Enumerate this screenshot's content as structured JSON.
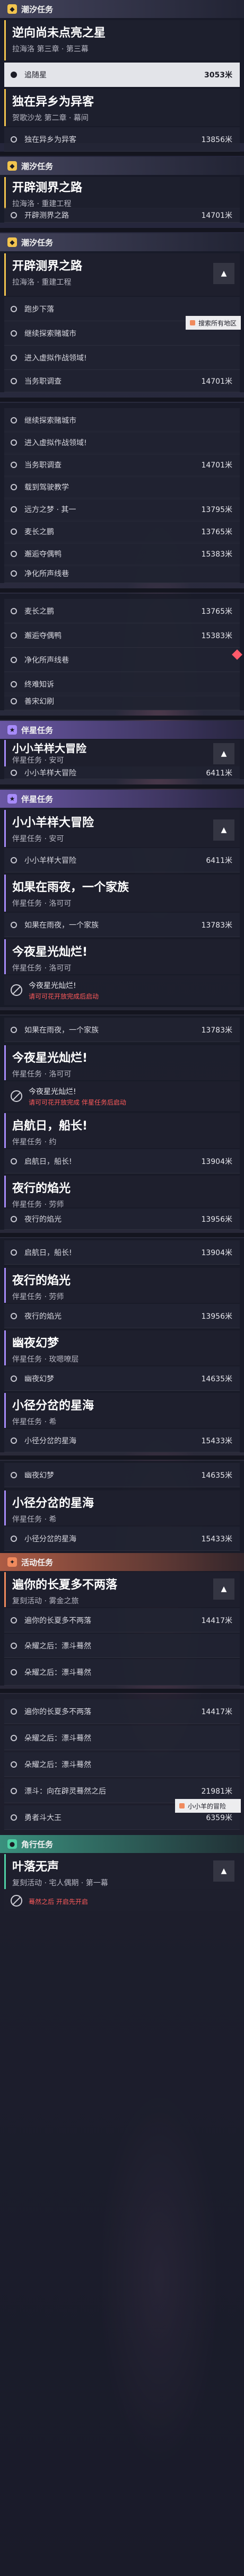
{
  "sections": {
    "main_label": "潮汐任务",
    "side_label": "伴星任务",
    "event_label": "活动任务",
    "daily_label": "角行任务"
  },
  "s1": {
    "title": "逆向尚未点亮之星",
    "sub": "拉海洛 第三章 · 第三幕",
    "active_row": {
      "label": "追随星",
      "dist": "3053米"
    },
    "card2_title": "独在异乡为异客",
    "card2_sub": "贺歌沙龙 第二章 · 幕间",
    "row2": {
      "label": "独在异乡为异客",
      "dist": "13856米"
    }
  },
  "s2": {
    "title": "开辟测界之路",
    "sub": "拉海洛 · 重建工程",
    "row": {
      "label": "开辟测界之路",
      "dist": "14701米"
    }
  },
  "s3": {
    "title": "开辟测界之路",
    "sub": "拉海洛 · 重建工程",
    "rows": [
      {
        "label": "跑步下落",
        "dist": ""
      },
      {
        "label": "继续探索赌城市",
        "dist": ""
      },
      {
        "label": "进入虚拟作战领域!",
        "dist": ""
      },
      {
        "label": "当务职调查",
        "dist": "14701米"
      }
    ],
    "tag": "搜索所有地区"
  },
  "s4": {
    "rows": [
      {
        "label": "继续探索赌城市",
        "dist": ""
      },
      {
        "label": "进入虚拟作战领域!",
        "dist": ""
      },
      {
        "label": "当务职调查",
        "dist": "14701米"
      },
      {
        "label": "载到驾驶教学",
        "dist": ""
      },
      {
        "label": "远方之梦 · 其一",
        "dist": "13795米"
      },
      {
        "label": "麦长之鹏",
        "dist": "13765米"
      },
      {
        "label": "邂逅夺偶鸭",
        "dist": "15383米"
      },
      {
        "label": "净化所声线巷",
        "dist": ""
      }
    ]
  },
  "s5": {
    "rows": [
      {
        "label": "麦长之鹏",
        "dist": "13765米"
      },
      {
        "label": "邂逅夺偶鸭",
        "dist": "15383米"
      },
      {
        "label": "净化所声线巷",
        "dist": ""
      },
      {
        "label": "终难知诉",
        "dist": ""
      },
      {
        "label": "善宋幻刷",
        "dist": ""
      }
    ]
  },
  "s6": {
    "title": "小小羊样大冒险",
    "sub": "伴星任务 · 安可",
    "row": {
      "label": "小小羊样大冒险",
      "dist": "6411米"
    }
  },
  "s7": {
    "card1_title": "小小羊样大冒险",
    "card1_sub": "伴星任务 · 安可",
    "row1": {
      "label": "小小羊样大冒险",
      "dist": "6411米"
    },
    "card2_title": "如果在雨夜，一个家族",
    "card2_sub": "伴星任务 · 洛可可",
    "row2": {
      "label": "如果在雨夜，一个家族",
      "dist": "13783米"
    },
    "card3_title": "今夜星光灿烂!",
    "card3_sub": "伴星任务 · 洛可可",
    "warn1_main": "今夜星光灿烂!",
    "warn1_red": "请可可花开放完成后启动"
  },
  "s8": {
    "row1": {
      "label": "如果在雨夜，一个家族",
      "dist": "13783米"
    },
    "card1_title": "今夜星光灿烂!",
    "card1_sub": "伴星任务 · 洛可可",
    "warn_main": "今夜星光灿烂!",
    "warn_red": "请可可花开放完成 伴星任务后启动",
    "card2_title": "启航日，船长!",
    "card2_sub": "伴星任务 · 约",
    "row2": {
      "label": "启航日，船长!",
      "dist": "13904米"
    },
    "card3_title": "夜行的焰光",
    "card3_sub": "伴星任务 · 劳师",
    "row3": {
      "label": "夜行的焰光",
      "dist": "13956米"
    }
  },
  "s9": {
    "row1": {
      "label": "启航日，船长!",
      "dist": "13904米"
    },
    "card1_title": "夜行的焰光",
    "card1_sub": "伴星任务 · 劳师",
    "row2": {
      "label": "夜行的焰光",
      "dist": "13956米"
    },
    "card2_title": "幽夜幻梦",
    "card2_sub": "伴星任务 · 玫嗯嘹层",
    "row3": {
      "label": "幽夜幻梦",
      "dist": "14635米"
    },
    "card3_title": "小径分岔的星海",
    "card3_sub": "伴星任务 · 希",
    "row4": {
      "label": "小径分岔的星海",
      "dist": "15433米"
    }
  },
  "s10": {
    "row1": {
      "label": "幽夜幻梦",
      "dist": "14635米"
    },
    "card1_title": "小径分岔的星海",
    "card1_sub": "伴星任务 · 希",
    "row2": {
      "label": "小径分岔的星海",
      "dist": "15433米"
    },
    "card2_title": "遍你的长夏多不两落",
    "card2_sub": "复刻活动 · 雾金之旅",
    "row3": {
      "label": "遍你的长夏多不两落",
      "dist": "14417米"
    },
    "row4": {
      "label": "朵耀之后：漂斗蓦然",
      "dist": ""
    },
    "row5": {
      "label": "朵耀之后：漂斗蓦然",
      "dist": ""
    }
  },
  "s11": {
    "row1": {
      "label": "遍你的长夏多不两落",
      "dist": "14417米"
    },
    "row2": {
      "label": "朵耀之后：漂斗蓦然",
      "dist": ""
    },
    "row3": {
      "label": "朵耀之后：漂斗蓦然",
      "dist": ""
    },
    "row4": {
      "label": "漂斗：向在辟灵蓦然之后",
      "dist": "21981米"
    },
    "row5": {
      "label": "勇者斗大王",
      "dist": "6359米"
    },
    "tag": "小小羊的冒险",
    "card_title": "叶落无声",
    "card_sub": "复刻活动 · 宅人偶期 · 第一幕",
    "warn_red": "蓦然之后 开启先开启"
  }
}
